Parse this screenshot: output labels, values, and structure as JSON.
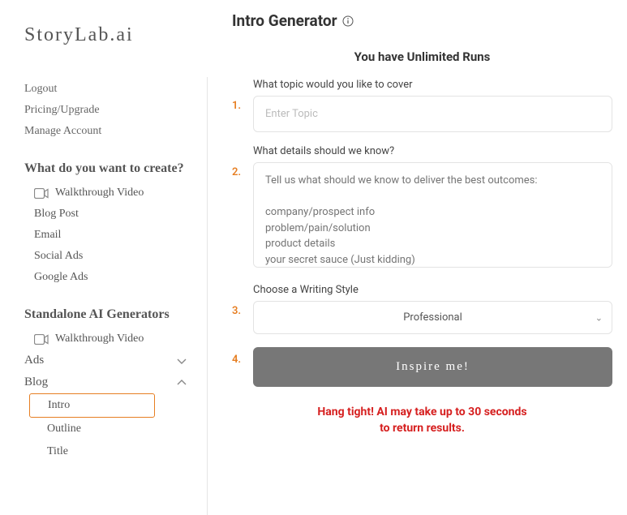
{
  "logo": "StoryLab.ai",
  "sidebar": {
    "account_links": [
      "Logout",
      "Pricing/Upgrade",
      "Manage Account"
    ],
    "create_heading": "What do you want to create?",
    "create_items": [
      "Walkthrough Video",
      "Blog Post",
      "Email",
      "Social Ads",
      "Google Ads"
    ],
    "standalone_heading": "Standalone AI Generators",
    "standalone_items": [
      "Walkthrough Video"
    ],
    "groups": {
      "ads": {
        "label": "Ads",
        "expanded": false
      },
      "blog": {
        "label": "Blog",
        "expanded": true,
        "children": [
          "Intro",
          "Outline",
          "Title"
        ],
        "active_index": 0
      }
    }
  },
  "main": {
    "title": "Intro Generator",
    "runs_banner": "You have Unlimited Runs",
    "fields": {
      "topic": {
        "label": "What topic would you like to cover",
        "placeholder": "Enter Topic"
      },
      "details": {
        "label": "What details should we know?",
        "placeholder": "Tell us what should we know to deliver the best outcomes:\n\ncompany/prospect info\nproblem/pain/solution\nproduct details\nyour secret sauce (Just kidding)"
      },
      "style": {
        "label": "Choose a Writing Style",
        "value": "Professional"
      }
    },
    "steps": {
      "s1": "1.",
      "s2": "2.",
      "s3": "3.",
      "s4": "4."
    },
    "submit_label": "Inspire me!",
    "wait_line1": "Hang tight! AI may take up to 30 seconds",
    "wait_line2": "to return results."
  }
}
